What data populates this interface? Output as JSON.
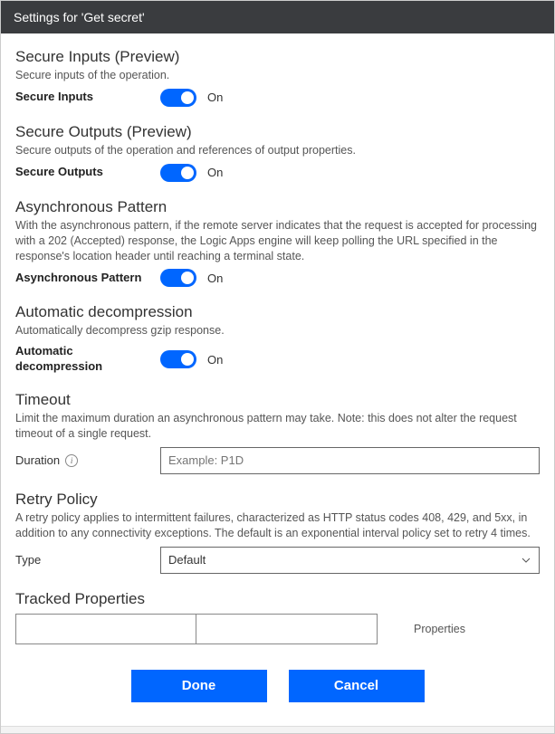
{
  "header": {
    "title": "Settings for 'Get secret'"
  },
  "sections": {
    "secure_inputs": {
      "title": "Secure Inputs (Preview)",
      "desc": "Secure inputs of the operation.",
      "toggle_label": "Secure Inputs",
      "state": "On"
    },
    "secure_outputs": {
      "title": "Secure Outputs (Preview)",
      "desc": "Secure outputs of the operation and references of output properties.",
      "toggle_label": "Secure Outputs",
      "state": "On"
    },
    "async_pattern": {
      "title": "Asynchronous Pattern",
      "desc": "With the asynchronous pattern, if the remote server indicates that the request is accepted for processing with a 202 (Accepted) response, the Logic Apps engine will keep polling the URL specified in the response's location header until reaching a terminal state.",
      "toggle_label": "Asynchronous Pattern",
      "state": "On"
    },
    "auto_decomp": {
      "title": "Automatic decompression",
      "desc": "Automatically decompress gzip response.",
      "toggle_label": "Automatic decompression",
      "state": "On"
    },
    "timeout": {
      "title": "Timeout",
      "desc": "Limit the maximum duration an asynchronous pattern may take. Note: this does not alter the request timeout of a single request.",
      "field_label": "Duration",
      "placeholder": "Example: P1D"
    },
    "retry": {
      "title": "Retry Policy",
      "desc": "A retry policy applies to intermittent failures, characterized as HTTP status codes 408, 429, and 5xx, in addition to any connectivity exceptions. The default is an exponential interval policy set to retry 4 times.",
      "field_label": "Type",
      "value": "Default"
    },
    "tracked": {
      "title": "Tracked Properties",
      "properties_label": "Properties"
    }
  },
  "buttons": {
    "done": "Done",
    "cancel": "Cancel"
  }
}
